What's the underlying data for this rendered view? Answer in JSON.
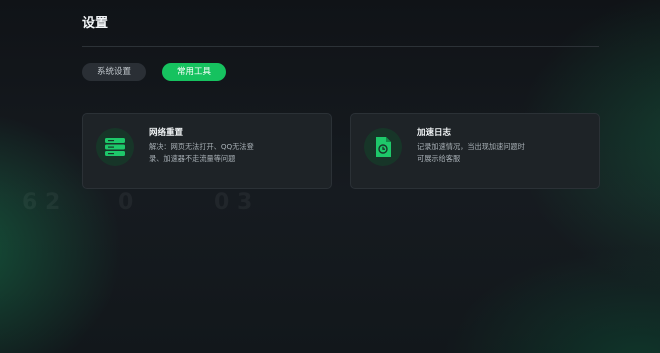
{
  "header": {
    "title": "设置"
  },
  "tabs": [
    {
      "label": "系统设置",
      "active": false
    },
    {
      "label": "常用工具",
      "active": true
    }
  ],
  "tools": [
    {
      "title": "网络重置",
      "description_lines": [
        "解决：网页无法打开、QQ无法登",
        "录、加速器不走流量等问题"
      ],
      "icon": "server-reset-icon"
    },
    {
      "title": "加速日志",
      "description_lines": [
        "记录加速情况，当出现加速问题时",
        "可展示给客服"
      ],
      "icon": "log-file-icon"
    }
  ],
  "colors": {
    "accent": "#16c25f",
    "background": "#14181c",
    "card": "#1e2327",
    "icon_bg": "#173528"
  }
}
